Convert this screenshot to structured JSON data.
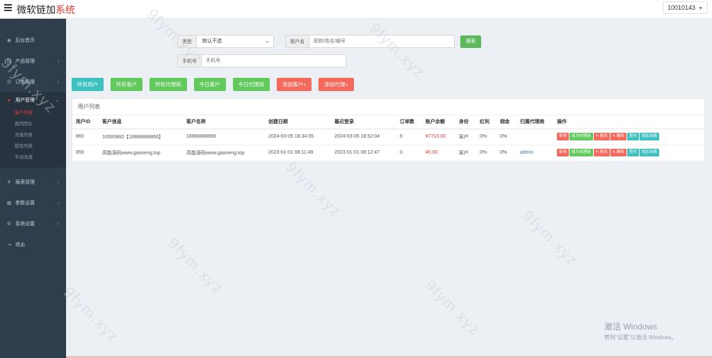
{
  "header": {
    "brand_main": "微软链加",
    "brand_accent": "系统",
    "account_id": "10010143"
  },
  "sidebar": {
    "items": [
      {
        "label": "后台首页",
        "icon": "dashboard-icon"
      },
      {
        "label": "产品管理",
        "icon": "product-icon"
      },
      {
        "label": "订单管理",
        "icon": "order-icon"
      },
      {
        "label": "用户管理",
        "icon": "user-icon"
      },
      {
        "label": "报表管理",
        "icon": "yen-icon"
      },
      {
        "label": "参数设置",
        "icon": "param-icon"
      },
      {
        "label": "系统设置",
        "icon": "settings-icon"
      },
      {
        "label": "退出",
        "icon": "logout-icon"
      }
    ],
    "submenu": [
      "客户列表",
      "我的团队",
      "充值列表",
      "提现列表",
      "手动充值"
    ]
  },
  "filters": {
    "type_label": "类型",
    "type_value": "默认不选",
    "username_label": "用户名",
    "username_placeholder": "昵称/姓名/编号",
    "search_label": "搜索",
    "phone_label": "手机号",
    "phone_placeholder": "手机号"
  },
  "actions": {
    "all_users": "所有用户",
    "all_customers": "所有客户",
    "all_agents": "所有代理商",
    "today_customers": "今日客户",
    "today_agents": "今日代理商",
    "add_customer": "添加客户+",
    "add_agent": "添加代理+"
  },
  "table": {
    "title": "用户列表",
    "columns": [
      "用户ID",
      "客户信息",
      "客户名称",
      "创建日期",
      "最近登录",
      "订单数",
      "账户余额",
      "身份",
      "红利",
      "佣金",
      "归属代理商",
      "操作"
    ],
    "row_buttons": [
      "禁用",
      "成为代理商",
      "✎ 修改",
      "✎ 删除",
      "签约",
      "增加余额"
    ],
    "rows": [
      {
        "id": "860",
        "info": "10000860【18888888866】",
        "name": "18888888866",
        "created": "2024-03-05 18:34:05",
        "last_login": "2024-03-05 18:52:04",
        "orders": "6",
        "balance": "¥7716.00",
        "role": "客户",
        "bonus": "0%",
        "commission": "0%",
        "agent": ""
      },
      {
        "id": "859",
        "info": "高能源码www.gaoneng.top",
        "name": "高能源码www.gaoneng.top",
        "created": "2023-01-01 08:11:49",
        "last_login": "2023-01-01 08:12:47",
        "orders": "0",
        "balance": "¥0.00",
        "role": "客户",
        "bonus": "0%",
        "commission": "0%",
        "agent": "admin"
      }
    ]
  },
  "watermark": "9fym.xyz",
  "windows_notice": {
    "title": "激活 Windows",
    "subtitle": "转到\"设置\"以激活 Windows。"
  },
  "colors": {
    "sidebar_bg": "#2f3e4d",
    "accent_red": "#e53935",
    "teal": "#3cc0c0",
    "green": "#62c95c",
    "salmon": "#f4695c"
  }
}
